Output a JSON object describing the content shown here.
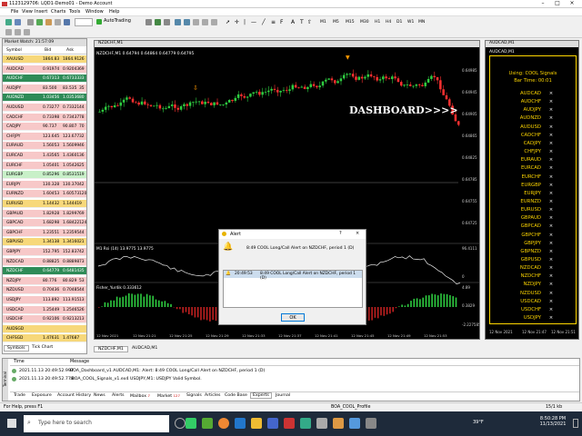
{
  "window": {
    "title": "1123129706: LQD1-Demo01 - Demo Account",
    "min": "–",
    "max": "□",
    "close": "×"
  },
  "menu": [
    "File",
    "View",
    "Insert",
    "Charts",
    "Tools",
    "Window",
    "Help"
  ],
  "toolbar": {
    "autotrading": "AutoTrading",
    "timeframes": [
      "M1",
      "M5",
      "M15",
      "M30",
      "H1",
      "H4",
      "D1",
      "W1",
      "MN"
    ]
  },
  "market_watch": {
    "title": "Market Watch: 21:57:09",
    "headers": [
      "Symbol",
      "Bid",
      "Ask",
      ""
    ],
    "rows": [
      {
        "symbol": "XAUUSD",
        "bid": "1864.83",
        "ask": "1864.91",
        "spread": "26",
        "bg": "#f7d87a"
      },
      {
        "symbol": "AUDCAD",
        "bid": "0.91974",
        "ask": "0.92043",
        "spread": "69",
        "bg": "#f7c8c8"
      },
      {
        "symbol": "AUDCHF",
        "bid": "0.67313",
        "ask": "0.67333",
        "spread": "33",
        "bg": "#2e8b57"
      },
      {
        "symbol": "AUDJPY",
        "bid": "83.500",
        "ask": "83.535",
        "spread": "35",
        "bg": "#f7c8c8"
      },
      {
        "symbol": "AUDNZD",
        "bid": "1.03456",
        "ask": "1.03536",
        "spread": "80",
        "bg": "#2e8b57"
      },
      {
        "symbol": "AUDUSD",
        "bid": "0.73277",
        "ask": "0.73321",
        "spread": "44",
        "bg": "#f7c8c8"
      },
      {
        "symbol": "CADCHF",
        "bid": "0.73398",
        "ask": "0.73437",
        "spread": "78",
        "bg": "#f7c8c8"
      },
      {
        "symbol": "CADJPY",
        "bid": "90.737",
        "ask": "90.807",
        "spread": "70",
        "bg": "#f7c8c8"
      },
      {
        "symbol": "CHFJPY",
        "bid": "123.645",
        "ask": "123.677",
        "spread": "32",
        "bg": "#f7c8c8"
      },
      {
        "symbol": "EURAUD",
        "bid": "1.56053",
        "ask": "1.56099",
        "spread": "46",
        "bg": "#f7c8c8"
      },
      {
        "symbol": "EURCAD",
        "bid": "1.43565",
        "ask": "1.43601",
        "spread": "36",
        "bg": "#f7c8c8"
      },
      {
        "symbol": "EURCHF",
        "bid": "1.05401",
        "ask": "1.05426",
        "spread": "25",
        "bg": "#f7c8c8"
      },
      {
        "symbol": "EURGBP",
        "bid": "0.85296",
        "ask": "0.85315",
        "spread": "19",
        "bg": "#c8f0c8"
      },
      {
        "symbol": "EURJPY",
        "bid": "130.328",
        "ask": "130.370",
        "spread": "42",
        "bg": "#f7c8c8"
      },
      {
        "symbol": "EURNZD",
        "bid": "1.60453",
        "ask": "1.60573",
        "spread": "120",
        "bg": "#f7c8c8"
      },
      {
        "symbol": "EURUSD",
        "bid": "1.14432",
        "ask": "1.14441",
        "spread": "9",
        "bg": "#f7d87a"
      },
      {
        "symbol": "GBPAUD",
        "bid": "1.82928",
        "ask": "1.82997",
        "spread": "69",
        "bg": "#f7c8c8"
      },
      {
        "symbol": "GBPCAD",
        "bid": "1.68298",
        "ask": "1.68422",
        "spread": "124",
        "bg": "#f7c8c8"
      },
      {
        "symbol": "GBPCHF",
        "bid": "1.23551",
        "ask": "1.23595",
        "spread": "44",
        "bg": "#f7c8c8"
      },
      {
        "symbol": "GBPUSD",
        "bid": "1.34138",
        "ask": "1.34160",
        "spread": "21",
        "bg": "#f7d87a"
      },
      {
        "symbol": "GBPJPY",
        "bid": "152.795",
        "ask": "152.837",
        "spread": "42",
        "bg": "#f7c8c8"
      },
      {
        "symbol": "NZDCAD",
        "bid": "0.88825",
        "ask": "0.88898",
        "spread": "73",
        "bg": "#f7c8c8"
      },
      {
        "symbol": "NZDCHF",
        "bid": "0.64779",
        "ask": "0.64814",
        "spread": "35",
        "bg": "#2e8b57"
      },
      {
        "symbol": "NZDJPY",
        "bid": "80.776",
        "ask": "80.829",
        "spread": "53",
        "bg": "#f7c8c8"
      },
      {
        "symbol": "NZDUSD",
        "bid": "0.70436",
        "ask": "0.70485",
        "spread": "44",
        "bg": "#f7c8c8"
      },
      {
        "symbol": "USDJPY",
        "bid": "113.892",
        "ask": "113.915",
        "spread": "13",
        "bg": "#f7c8c8"
      },
      {
        "symbol": "USDCAD",
        "bid": "1.25449",
        "ask": "1.25465",
        "spread": "26",
        "bg": "#f7c8c8"
      },
      {
        "symbol": "USDCHF",
        "bid": "0.92106",
        "ask": "0.92132",
        "spread": "13",
        "bg": "#f7c8c8"
      },
      {
        "symbol": "AUDSGD",
        "bid": "",
        "ask": "",
        "spread": "",
        "bg": "#f7d87a"
      },
      {
        "symbol": "CHFSGD",
        "bid": "1.47631",
        "ask": "1.47687",
        "spread": "",
        "bg": "#f7d87a"
      }
    ],
    "tabs": [
      "Symbols",
      "Tick Chart"
    ]
  },
  "main_chart": {
    "window_title": "NZDCHF,M1",
    "info": "NZDCHF,M1  0.64794 0.64864 0.64779 0.64795",
    "price_labels": [
      "0.64985",
      "0.64945",
      "0.64905",
      "0.64865",
      "0.64825",
      "0.64785",
      "0.64755",
      "0.64725"
    ],
    "rsi_label": "M1 Rsi (14)  13.9775  13.9775",
    "rsi_values": [
      "96.4111",
      "0"
    ],
    "osc_label": "Fisher_Yur4ik 0.333612",
    "osc_values": [
      "4.89",
      "0.3829",
      "-2.227585"
    ],
    "time_labels": [
      "12 Nov 2021",
      "12 Nov 21:21",
      "12 Nov 21:25",
      "12 Nov 21:29",
      "12 Nov 21:33",
      "12 Nov 21:37",
      "12 Nov 21:41",
      "12 Nov 21:45",
      "12 Nov 21:49",
      "12 Nov 21:53"
    ],
    "annotation": "DASHBOARD>>>>"
  },
  "dash_chart": {
    "window_title": "AUDCAD,M1",
    "info": "AUDCAD,M1",
    "signal_label": "Using: COOL Signals",
    "bar_time": "Bar Time: 00:01",
    "pairs": [
      "AUDCAD",
      "AUDCHF",
      "AUDJPY",
      "AUDNZD",
      "AUDUSD",
      "CADCHF",
      "CADJPY",
      "CHFJPY",
      "EURAUD",
      "EURCAD",
      "EURCHF",
      "EURGBP",
      "EURJPY",
      "EURNZD",
      "EURUSD",
      "GBPAUD",
      "GBPCAD",
      "GBPCHF",
      "GBPJPY",
      "GBPNZD",
      "GBPUSD",
      "NZDCAD",
      "NZDCHF",
      "NZDJPY",
      "NZDUSD",
      "USDCAD",
      "USDCHF",
      "USDJPY"
    ],
    "mark": "×",
    "time_labels": [
      "12 Nov 2021",
      "12 Nov 21:47",
      "12 Nov 21:51"
    ]
  },
  "chart_tabs": [
    "NZDCHF,M1",
    "AUDCAD,M1"
  ],
  "alert": {
    "title": "Alert",
    "help": "?",
    "close": "×",
    "message": "8:49 COOL Long/Call Alert on NZDCHF, period 1 (D)",
    "log_time": "20:49:53",
    "log_msg": "8:49 COOL Long/Call Alert on NZDCHF, period 1 (D)",
    "ok": "OK"
  },
  "terminal": {
    "headers": [
      "Time",
      "Message"
    ],
    "rows": [
      {
        "time": "2021.11.13 20:49:52.997",
        "msg": "BOA_Dashboard_v1 AUDCAD,M1: Alert: 8:49 COOL Long/Call Alert on NZDCHF, period 1 (D)"
      },
      {
        "time": "2021.11.13 20:49:52.778",
        "msg": ":BOA_COOL_Signals_v1.ex4 USDJPY,M1: USDJPY Valid Symbol."
      }
    ],
    "side_label": "Terminal",
    "tabs": [
      "Trade",
      "Exposure",
      "Account History",
      "News",
      "Alerts",
      "Mailbox",
      "Market",
      "Signals",
      "Articles",
      "Code Base",
      "Experts",
      "Journal"
    ],
    "mailbox_badge": "7",
    "market_badge": "127"
  },
  "status": {
    "left": "For Help, press F1",
    "profile": "BOA_COOL_Profile",
    "right": "15/1 kb"
  },
  "taskbar": {
    "search": "Type here to search",
    "time": "8:50:28 PM",
    "date": "11/13/2021",
    "weather": "39°F"
  }
}
